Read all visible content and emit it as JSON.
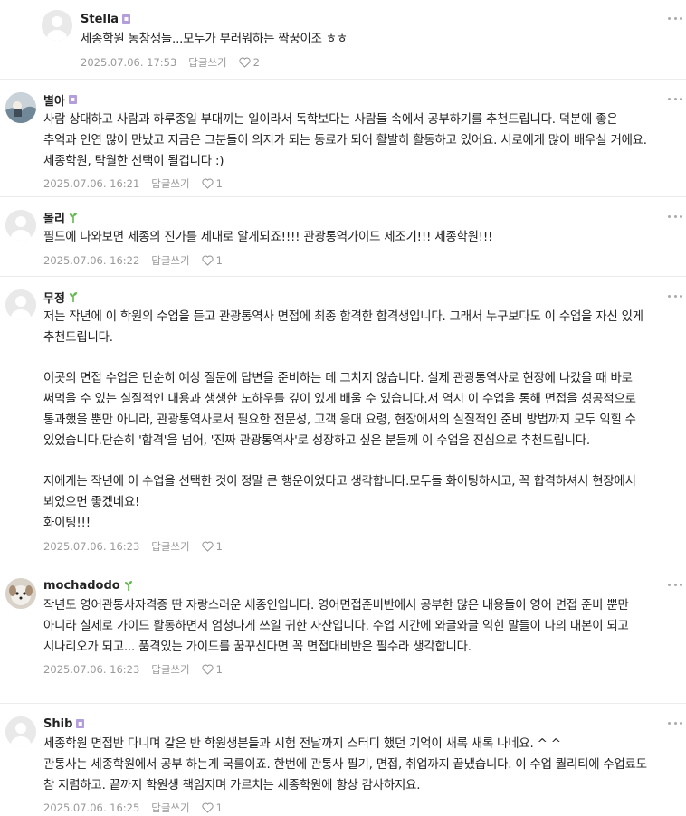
{
  "comments": [
    {
      "author": "Stella",
      "badge": "manager",
      "text": [
        "세종학원 동창생들...모두가 부러워하는 짝꿍이조 ㅎㅎ"
      ],
      "date": "2025.07.06. 17:53",
      "reply_label": "답글쓰기",
      "likes": "2"
    },
    {
      "author": "별아",
      "badge": "manager",
      "text": [
        "사람 상대하고 사람과 하루종일 부대끼는 일이라서 독학보다는 사람들 속에서 공부하기를 추천드립니다. 덕분에 좋은 추억과 인연 많이 만났고 지금은 그분들이 의지가 되는 동료가 되어 활발히 활동하고 있어요. 서로에게 많이 배우실 거에요. 세종학원, 탁월한 선택이 될겁니다 :)"
      ],
      "date": "2025.07.06. 16:21",
      "reply_label": "답글쓰기",
      "likes": "1"
    },
    {
      "author": "몰리",
      "badge": "sprout",
      "text": [
        "필드에 나와보면 세종의 진가를 제대로 알게되죠!!!! 관광통역가이드 제조기!!! 세종학원!!!"
      ],
      "date": "2025.07.06. 16:22",
      "reply_label": "답글쓰기",
      "likes": "1"
    },
    {
      "author": "무정",
      "badge": "sprout",
      "text": [
        "저는 작년에 이 학원의 수업을 듣고 관광통역사 면접에 최종 합격한 합격생입니다. 그래서 누구보다도 이 수업을 자신 있게 추천드립니다.",
        "이곳의 면접 수업은 단순히 예상 질문에 답변을 준비하는 데 그치지 않습니다. 실제 관광통역사로 현장에 나갔을 때 바로 써먹을 수 있는 실질적인 내용과 생생한 노하우를 깊이 있게 배울 수 있습니다.저 역시 이 수업을 통해 면접을 성공적으로 통과했을 뿐만 아니라, 관광통역사로서 필요한 전문성, 고객 응대 요령, 현장에서의 실질적인 준비 방법까지 모두 익힐 수 있었습니다.단순히 '합격'을 넘어, '진짜 관광통역사'로 성장하고 싶은 분들께 이 수업을 진심으로 추천드립니다.",
        "저에게는 작년에 이 수업을 선택한 것이 정말 큰 행운이었다고 생각합니다.모두들 화이팅하시고, 꼭 합격하셔서 현장에서 뵈었으면 좋겠네요!\n화이팅!!!"
      ],
      "date": "2025.07.06. 16:23",
      "reply_label": "답글쓰기",
      "likes": "1"
    },
    {
      "author": "mochadodo",
      "badge": "sprout",
      "text": [
        "작년도 영어관통사자격증 딴 자랑스러운 세종인입니다. 영어면접준비반에서 공부한 많은 내용들이 영어 면접 준비 뿐만 아니라 실제로 가이드 활동하면서 엄청나게 쓰일 귀한 자산입니다. 수업 시간에 와글와글 익힌 말들이 나의 대본이 되고 시나리오가 되고... 품격있는 가이드를 꿈꾸신다면 꼭 면접대비반은 필수라 생각합니다."
      ],
      "date": "2025.07.06. 16:23",
      "reply_label": "답글쓰기",
      "likes": "1"
    },
    {
      "author": "Shib",
      "badge": "manager",
      "text": [
        "세종학원 면접반 다니며 같은 반 학원생분들과 시험 전날까지 스터디 했던 기억이 새록 새록 나네요. ^ ^\n관통사는 세종학원에서 공부 하는게 국룰이죠. 한번에 관통사 필기, 면접, 취업까지 끝냈습니다. 이 수업 퀄리티에 수업료도 참 저렴하고. 끝까지 학원생 책임지며 가르치는 세종학원에 항상 감사하지요."
      ],
      "date": "2025.07.06. 16:25",
      "reply_label": "답글쓰기",
      "likes": "1"
    }
  ]
}
